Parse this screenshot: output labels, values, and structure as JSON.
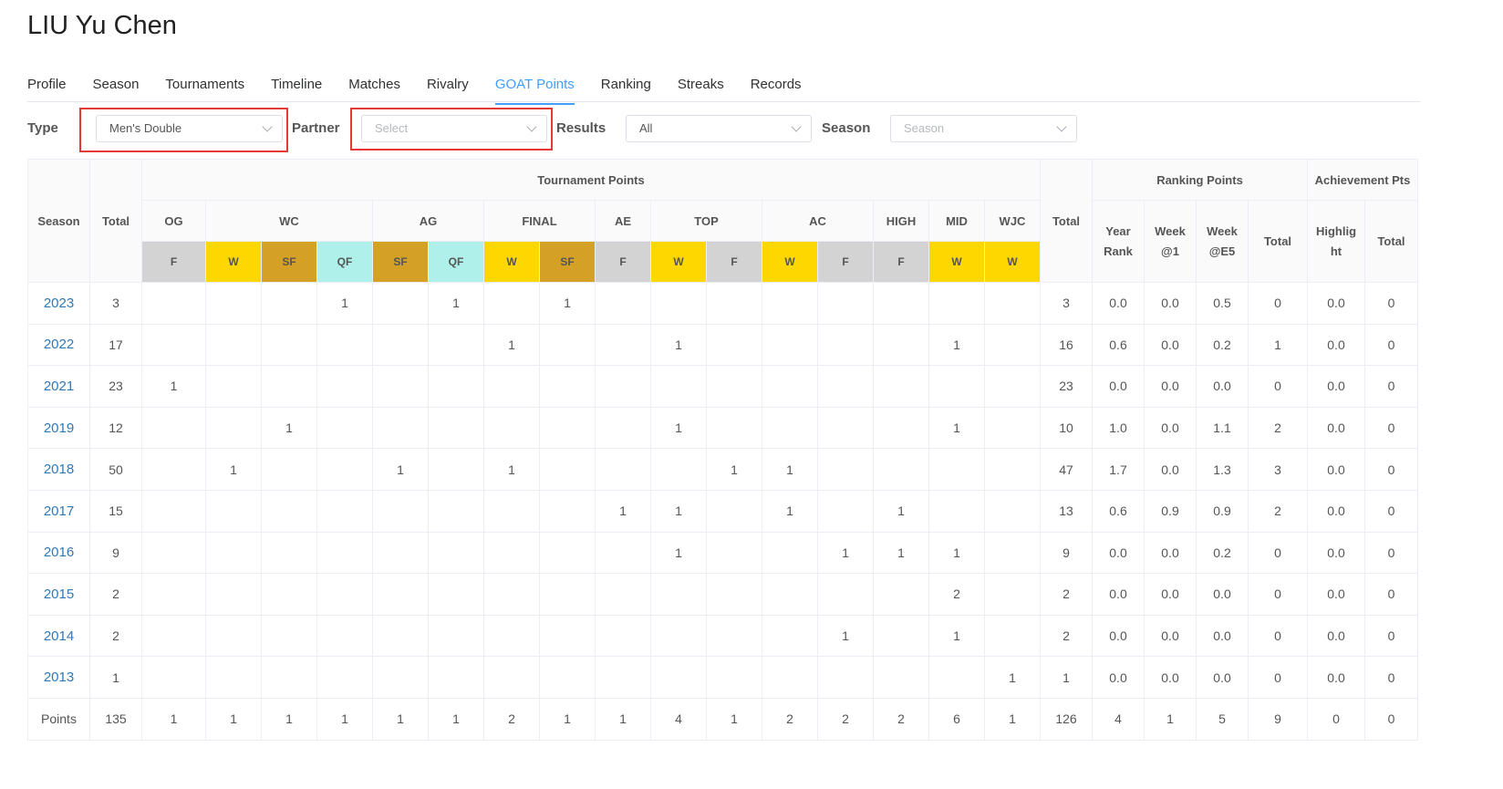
{
  "title": "LIU Yu Chen",
  "tabs": [
    "Profile",
    "Season",
    "Tournaments",
    "Timeline",
    "Matches",
    "Rivalry",
    "GOAT Points",
    "Ranking",
    "Streaks",
    "Records"
  ],
  "active_tab": "GOAT Points",
  "filters": {
    "type_label": "Type",
    "type_value": "Men's Double",
    "partner_label": "Partner",
    "partner_placeholder": "Select",
    "results_label": "Results",
    "results_value": "All",
    "season_label": "Season",
    "season_placeholder": "Season"
  },
  "headers": {
    "season": "Season",
    "total": "Total",
    "tournament_points": "Tournament Points",
    "ranking_points": "Ranking Points",
    "achievement_points": "Achievement Pts",
    "groups": [
      {
        "name": "OG",
        "results": [
          "F"
        ]
      },
      {
        "name": "WC",
        "results": [
          "W",
          "SF",
          "QF"
        ]
      },
      {
        "name": "AG",
        "results": [
          "SF",
          "QF"
        ]
      },
      {
        "name": "FINAL",
        "results": [
          "W",
          "SF"
        ]
      },
      {
        "name": "AE",
        "results": [
          "F"
        ]
      },
      {
        "name": "TOP",
        "results": [
          "W",
          "F"
        ]
      },
      {
        "name": "AC",
        "results": [
          "W",
          "F"
        ]
      },
      {
        "name": "HIGH",
        "results": [
          "F"
        ]
      },
      {
        "name": "MID",
        "results": [
          "W"
        ]
      },
      {
        "name": "WJC",
        "results": [
          "W"
        ]
      }
    ],
    "tournament_total": "Total",
    "year_rank_1": "Year",
    "year_rank_2": "Rank",
    "week1_1": "Week",
    "week1_2": "@1",
    "weekE5_1": "Week",
    "weekE5_2": "@E5",
    "ranking_total": "Total",
    "highlight_1": "Highlig",
    "highlight_2": "ht",
    "achievement_total": "Total"
  },
  "colors": {
    "W": "#ffd700",
    "SF": "#d4a026",
    "QF": "#aff0ea",
    "F": "#d3d3d3",
    "link": "#2f78b7",
    "active_tab": "#409eff",
    "highlight_box": "#e53935"
  },
  "rows": [
    {
      "season": "2023",
      "total": "3",
      "cells": [
        "",
        "",
        "",
        "1",
        "",
        "1",
        "",
        "1",
        "",
        "",
        "",
        "",
        "",
        "",
        "",
        "",
        ""
      ],
      "t_total": "3",
      "year_rank": "0.0",
      "week1": "0.0",
      "weekE5": "0.5",
      "r_total": "0",
      "highlight": "0.0",
      "a_total": "0"
    },
    {
      "season": "2022",
      "total": "17",
      "cells": [
        "",
        "",
        "",
        "",
        "",
        "",
        "1",
        "",
        "",
        "1",
        "",
        "",
        "",
        "",
        "1",
        ""
      ],
      "t_total": "16",
      "year_rank": "0.6",
      "week1": "0.0",
      "weekE5": "0.2",
      "r_total": "1",
      "highlight": "0.0",
      "a_total": "0"
    },
    {
      "season": "2021",
      "total": "23",
      "cells": [
        "1",
        "",
        "",
        "",
        "",
        "",
        "",
        "",
        "",
        "",
        "",
        "",
        "",
        "",
        "",
        ""
      ],
      "t_total": "23",
      "year_rank": "0.0",
      "week1": "0.0",
      "weekE5": "0.0",
      "r_total": "0",
      "highlight": "0.0",
      "a_total": "0"
    },
    {
      "season": "2019",
      "total": "12",
      "cells": [
        "",
        "",
        "1",
        "",
        "",
        "",
        "",
        "",
        "",
        "1",
        "",
        "",
        "",
        "",
        "1",
        ""
      ],
      "t_total": "10",
      "year_rank": "1.0",
      "week1": "0.0",
      "weekE5": "1.1",
      "r_total": "2",
      "highlight": "0.0",
      "a_total": "0"
    },
    {
      "season": "2018",
      "total": "50",
      "cells": [
        "",
        "1",
        "",
        "",
        "1",
        "",
        "1",
        "",
        "",
        "",
        "1",
        "1",
        "",
        "",
        "",
        ""
      ],
      "t_total": "47",
      "year_rank": "1.7",
      "week1": "0.0",
      "weekE5": "1.3",
      "r_total": "3",
      "highlight": "0.0",
      "a_total": "0"
    },
    {
      "season": "2017",
      "total": "15",
      "cells": [
        "",
        "",
        "",
        "",
        "",
        "",
        "",
        "",
        "1",
        "1",
        "",
        "1",
        "",
        "1",
        "",
        ""
      ],
      "t_total": "13",
      "year_rank": "0.6",
      "week1": "0.9",
      "weekE5": "0.9",
      "r_total": "2",
      "highlight": "0.0",
      "a_total": "0"
    },
    {
      "season": "2016",
      "total": "9",
      "cells": [
        "",
        "",
        "",
        "",
        "",
        "",
        "",
        "",
        "",
        "1",
        "",
        "",
        "1",
        "1",
        "1",
        ""
      ],
      "t_total": "9",
      "year_rank": "0.0",
      "week1": "0.0",
      "weekE5": "0.2",
      "r_total": "0",
      "highlight": "0.0",
      "a_total": "0"
    },
    {
      "season": "2015",
      "total": "2",
      "cells": [
        "",
        "",
        "",
        "",
        "",
        "",
        "",
        "",
        "",
        "",
        "",
        "",
        "",
        "",
        "2",
        ""
      ],
      "t_total": "2",
      "year_rank": "0.0",
      "week1": "0.0",
      "weekE5": "0.0",
      "r_total": "0",
      "highlight": "0.0",
      "a_total": "0"
    },
    {
      "season": "2014",
      "total": "2",
      "cells": [
        "",
        "",
        "",
        "",
        "",
        "",
        "",
        "",
        "",
        "",
        "",
        "",
        "1",
        "",
        "1",
        ""
      ],
      "t_total": "2",
      "year_rank": "0.0",
      "week1": "0.0",
      "weekE5": "0.0",
      "r_total": "0",
      "highlight": "0.0",
      "a_total": "0"
    },
    {
      "season": "2013",
      "total": "1",
      "cells": [
        "",
        "",
        "",
        "",
        "",
        "",
        "",
        "",
        "",
        "",
        "",
        "",
        "",
        "",
        "",
        "1"
      ],
      "t_total": "1",
      "year_rank": "0.0",
      "week1": "0.0",
      "weekE5": "0.0",
      "r_total": "0",
      "highlight": "0.0",
      "a_total": "0"
    }
  ],
  "points_row": {
    "label": "Points",
    "total": "135",
    "cells": [
      "1",
      "1",
      "1",
      "1",
      "1",
      "1",
      "2",
      "1",
      "1",
      "4",
      "1",
      "2",
      "2",
      "2",
      "6",
      "1"
    ],
    "t_total": "126",
    "year_rank": "4",
    "week1": "1",
    "weekE5": "5",
    "r_total": "9",
    "highlight": "0",
    "a_total": "0"
  }
}
